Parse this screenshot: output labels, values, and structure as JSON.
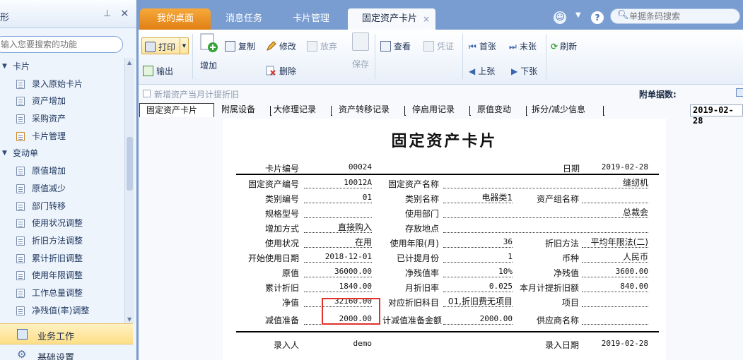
{
  "left_panel": {
    "title": "形",
    "pin_icon": "pin-icon",
    "close_icon": "close-icon",
    "search_placeholder": "输入您要搜索的功能",
    "tree": [
      {
        "label": "卡片",
        "type": "group",
        "expanded": true
      },
      {
        "label": "录入原始卡片",
        "type": "leaf"
      },
      {
        "label": "资产增加",
        "type": "leaf"
      },
      {
        "label": "采购资产",
        "type": "leaf"
      },
      {
        "label": "卡片管理",
        "type": "leaf",
        "selected": true
      },
      {
        "label": "变动单",
        "type": "group",
        "expanded": true
      },
      {
        "label": "原值增加",
        "type": "leaf"
      },
      {
        "label": "原值减少",
        "type": "leaf"
      },
      {
        "label": "部门转移",
        "type": "leaf"
      },
      {
        "label": "使用状况调整",
        "type": "leaf"
      },
      {
        "label": "折旧方法调整",
        "type": "leaf"
      },
      {
        "label": "累计折旧调整",
        "type": "leaf"
      },
      {
        "label": "使用年限调整",
        "type": "leaf"
      },
      {
        "label": "工作总量调整",
        "type": "leaf"
      },
      {
        "label": "净残值(率)调整",
        "type": "leaf"
      }
    ],
    "nav": {
      "business": "业务工作",
      "basic": "基础设置"
    }
  },
  "tabs": [
    {
      "label": "我的桌面"
    },
    {
      "label": "消息任务"
    },
    {
      "label": "卡片管理"
    },
    {
      "label": "固定资产卡片",
      "active": true
    }
  ],
  "topbar": {
    "search_placeholder": "单据条码搜索",
    "tab_close": "×"
  },
  "toolbar": {
    "print": "打印",
    "export": "输出",
    "add": "增加",
    "copy": "复制",
    "edit": "修改",
    "abandon": "放弃",
    "delete": "删除",
    "save": "保存",
    "view": "查看",
    "voucher": "凭证",
    "first": "首张",
    "last": "末张",
    "prev": "上张",
    "next": "下张",
    "refresh": "刷新"
  },
  "options": {
    "checkbox_label": "新增资产当月计提折旧",
    "attachment_label": "附单据数:"
  },
  "subtabs": [
    "固定资产卡片",
    "附属设备",
    "大修理记录",
    "资产转移记录",
    "停启用记录",
    "原值变动",
    "拆分/减少信息"
  ],
  "date_field": "2019-02-28",
  "card": {
    "title": "固定资产卡片",
    "card_no_label": "卡片编号",
    "card_no": "00024",
    "date_label": "日期",
    "date": "2019-02-28",
    "asset_no_label": "固定资产编号",
    "asset_no": "10012A",
    "asset_name_label": "固定资产名称",
    "asset_name": "缝纫机",
    "cat_no_label": "类别编号",
    "cat_no": "01",
    "cat_name_label": "类别名称",
    "cat_name": "电器类1",
    "group_label": "资产组名称",
    "group": "",
    "spec_label": "规格型号",
    "spec": "",
    "dept_label": "使用部门",
    "dept": "总裁会",
    "add_method_label": "增加方式",
    "add_method": "直接购入",
    "location_label": "存放地点",
    "location": "",
    "status_label": "使用状况",
    "status": "在用",
    "life_label": "使用年限(月)",
    "life": "36",
    "method_label": "折旧方法",
    "method": "平均年限法(二)",
    "start_label": "开始使用日期",
    "start": "2018-12-01",
    "accrued_label": "已计提月份",
    "accrued": "1",
    "currency_label": "币种",
    "currency": "人民币",
    "orig_label": "原值",
    "orig": "36000.00",
    "salv_rate_label": "净残值率",
    "salv_rate": "10%",
    "salv_label": "净残值",
    "salv": "3600.00",
    "acc_dep_label": "累计折旧",
    "acc_dep": "1840.00",
    "month_rate_label": "月折旧率",
    "month_rate": "0.025",
    "month_dep_label": "本月计提折旧额",
    "month_dep": "840.00",
    "net_label": "净值",
    "net": "32160.00",
    "subj_label": "对应折旧科目",
    "subj": "01,折旧费无项目",
    "item_label": "项目",
    "item": "",
    "impair_label": "减值准备",
    "impair": "2000.00",
    "impair_total_label": "计减值准备金额",
    "impair_total": "2000.00",
    "supplier_label": "供应商名称",
    "supplier": "",
    "entered_by_label": "录入人",
    "entered_by": "demo",
    "entry_date_label": "录入日期",
    "entry_date": "2019-02-28"
  },
  "colors": {
    "accent_orange": "#e98b1d",
    "frame_blue": "#7a9dd1",
    "highlight_red": "#e0312b"
  }
}
